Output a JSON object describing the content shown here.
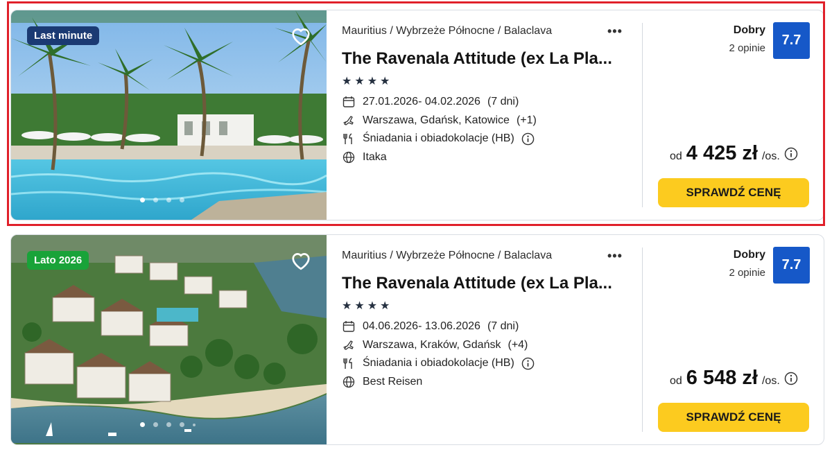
{
  "colors": {
    "accent_yellow": "#fccb1f",
    "rating_blue": "#1658c8",
    "badge_dark_blue": "#1b3a73",
    "badge_green": "#19a339",
    "highlight_red": "#e0202a"
  },
  "offers": [
    {
      "badge": "Last minute",
      "breadcrumb": "Mauritius / Wybrzeże Północne / Balaclava",
      "more_label": "•••",
      "title": "The Ravenala Attitude (ex La Pla...",
      "stars": 4,
      "dates": "27.01.2026- 04.02.2026",
      "duration": "(7 dni)",
      "departure": "Warszawa, Gdańsk, Katowice",
      "departure_more": "(+1)",
      "board": "Śniadania i obiadokolacje (HB)",
      "operator": "Itaka",
      "rating_word": "Dobry",
      "rating_count": "2 opinie",
      "rating_score": "7.7",
      "price_prefix": "od",
      "price": "4 425 zł",
      "price_suffix": "/os.",
      "cta": "SPRAWDŹ CENĘ",
      "image_dots": 4,
      "highlighted": true
    },
    {
      "badge": "Lato 2026",
      "breadcrumb": "Mauritius / Wybrzeże Północne / Balaclava",
      "more_label": "•••",
      "title": "The Ravenala Attitude (ex La Pla...",
      "stars": 4,
      "dates": "04.06.2026- 13.06.2026",
      "duration": "(7 dni)",
      "departure": "Warszawa, Kraków, Gdańsk",
      "departure_more": "(+4)",
      "board": "Śniadania i obiadokolacje (HB)",
      "operator": "Best Reisen",
      "rating_word": "Dobry",
      "rating_count": "2 opinie",
      "rating_score": "7.7",
      "price_prefix": "od",
      "price": "6 548 zł",
      "price_suffix": "/os.",
      "cta": "SPRAWDŹ CENĘ",
      "image_dots": 5,
      "highlighted": false
    }
  ]
}
